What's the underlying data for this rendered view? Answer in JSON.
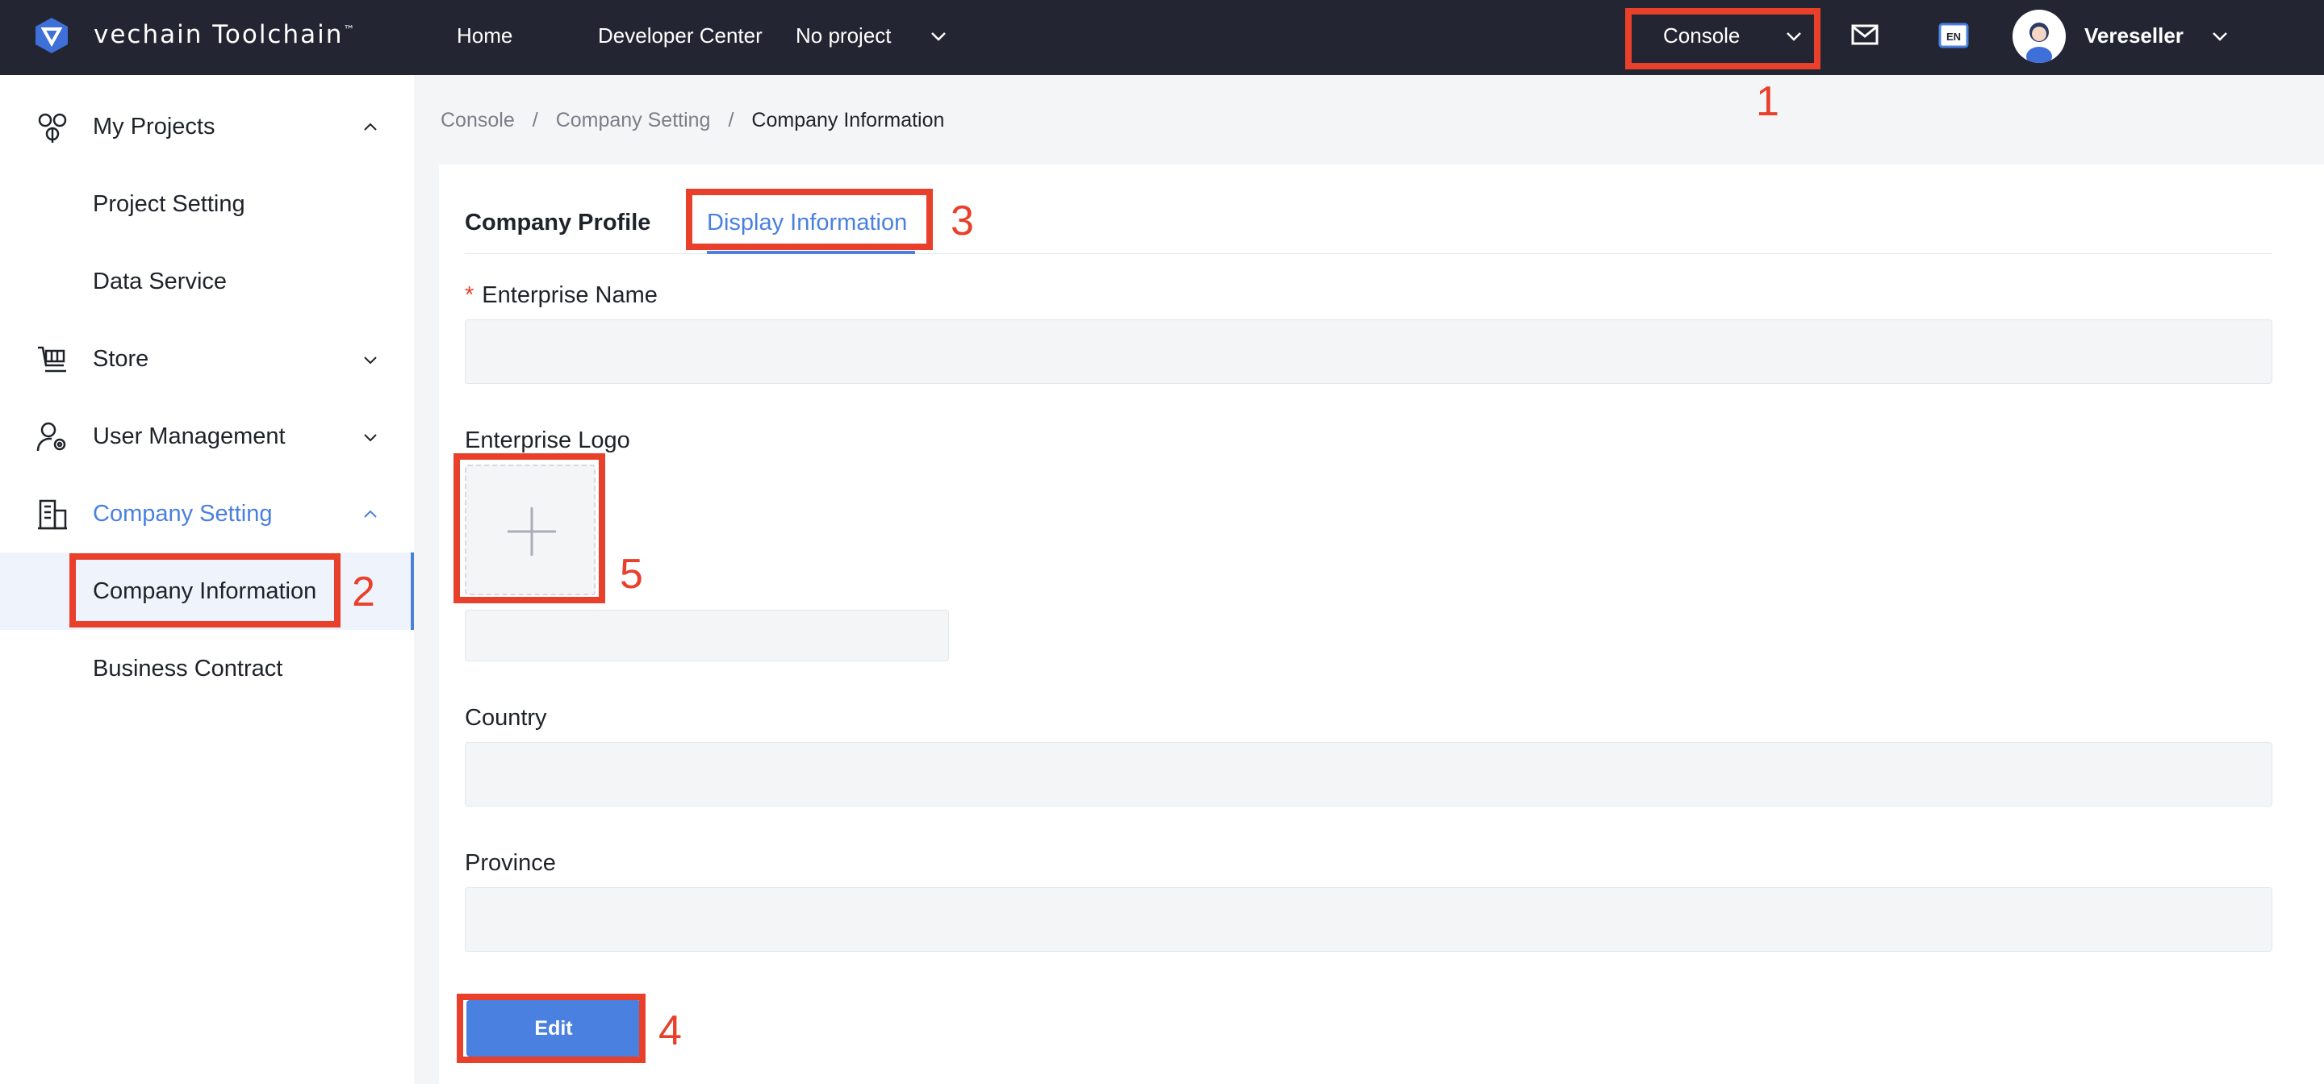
{
  "header": {
    "brand": "vechain Toolchain",
    "brand_mark": "™",
    "nav": {
      "home": "Home",
      "developer_center": "Developer Center",
      "project_select": "No project"
    },
    "console_label": "Console",
    "username": "Vereseller",
    "icons": [
      "vechain-logo-icon",
      "mail-icon",
      "language-en-icon",
      "avatar"
    ]
  },
  "sidebar": {
    "items": [
      {
        "label": "My Projects",
        "icon": "cube-network-icon",
        "expanded": true
      },
      {
        "label": "Project Setting"
      },
      {
        "label": "Data Service"
      },
      {
        "label": "Store",
        "icon": "store-icon",
        "expanded": false
      },
      {
        "label": "User Management",
        "icon": "user-gear-icon",
        "expanded": false
      },
      {
        "label": "Company Setting",
        "icon": "building-icon",
        "expanded": true,
        "active": true
      },
      {
        "label": "Company Information",
        "active": true
      },
      {
        "label": "Business Contract"
      }
    ]
  },
  "breadcrumb": {
    "items": [
      "Console",
      "Company Setting",
      "Company Information"
    ],
    "separator": "/"
  },
  "tabs": {
    "items": [
      "Company Profile",
      "Display Information"
    ],
    "active": "Display Information"
  },
  "form": {
    "enterprise_name": {
      "label": "Enterprise Name",
      "required_mark": "*",
      "value": ""
    },
    "enterprise_logo": {
      "label": "Enterprise Logo"
    },
    "logo_caption": {
      "value": ""
    },
    "country": {
      "label": "Country",
      "value": ""
    },
    "province": {
      "label": "Province",
      "value": ""
    },
    "edit_button": "Edit"
  },
  "annotations": [
    "1",
    "2",
    "3",
    "4",
    "5"
  ],
  "colors": {
    "topbar": "#232632",
    "accent": "#4a80e0",
    "annotation": "#e8402a",
    "page_bg": "#f4f5f7"
  }
}
